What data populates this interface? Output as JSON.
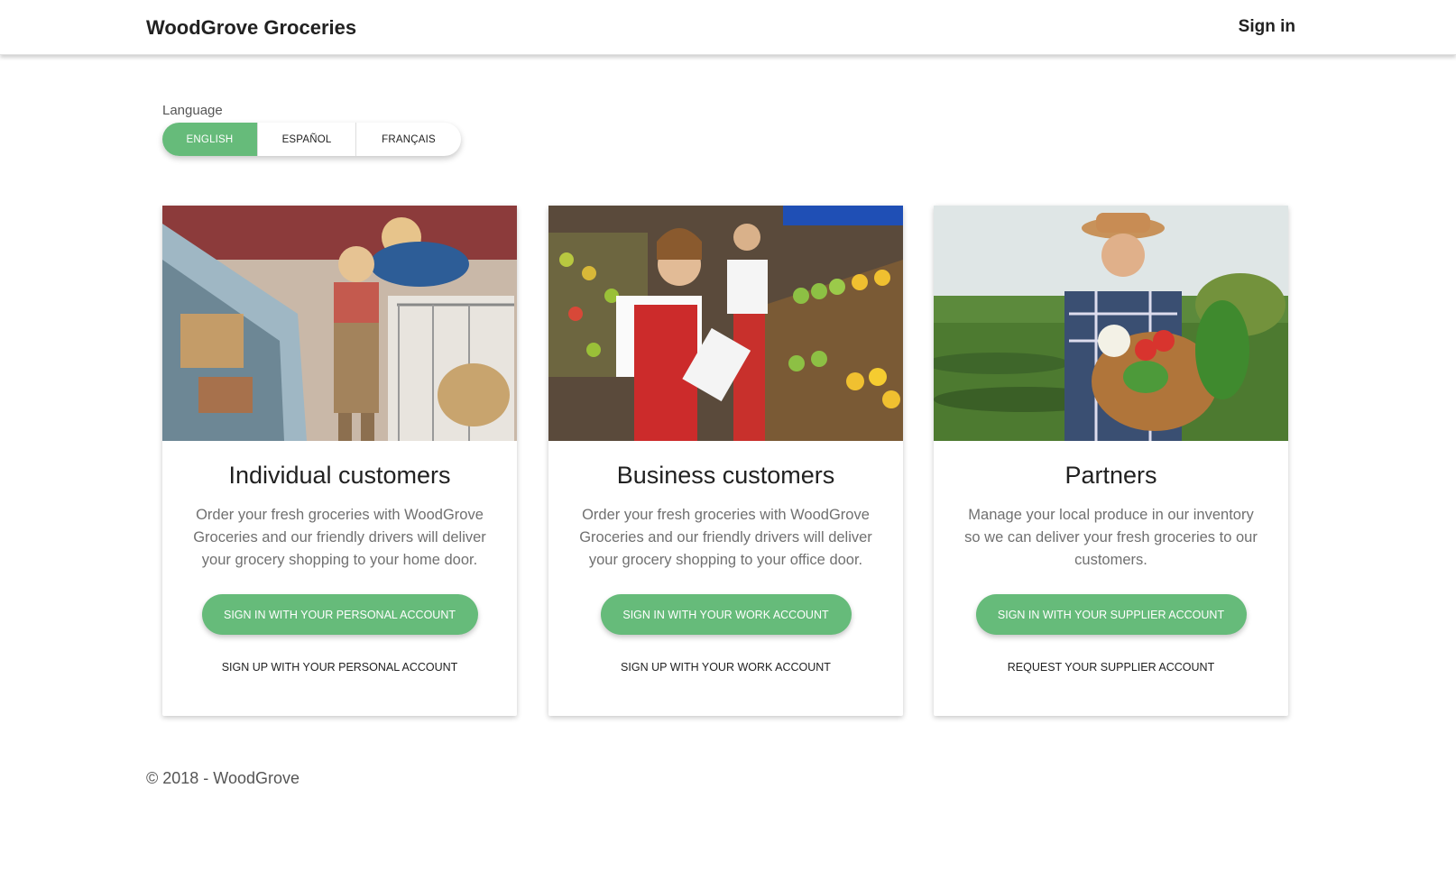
{
  "header": {
    "brand": "WoodGrove Groceries",
    "sign_in": "Sign in"
  },
  "language": {
    "label": "Language",
    "options": [
      "ENGLISH",
      "ESPAÑOL",
      "FRANÇAIS"
    ],
    "selected": "ENGLISH"
  },
  "cards": [
    {
      "title": "Individual customers",
      "text": "Order your fresh groceries with WoodGrove Groceries and our friendly drivers will deliver your grocery shopping to your home door.",
      "primary": "SIGN IN WITH YOUR PERSONAL ACCOUNT",
      "secondary": "SIGN UP WITH YOUR PERSONAL ACCOUNT"
    },
    {
      "title": "Business customers",
      "text": "Order your fresh groceries with WoodGrove Groceries and our friendly drivers will deliver your grocery shopping to your office door.",
      "primary": "SIGN IN WITH YOUR WORK ACCOUNT",
      "secondary": "SIGN UP WITH YOUR WORK ACCOUNT"
    },
    {
      "title": "Partners",
      "text": "Manage your local produce in our inventory so we can deliver your fresh groceries to our customers.",
      "primary": "SIGN IN WITH YOUR SUPPLIER ACCOUNT",
      "secondary": "REQUEST YOUR SUPPLIER ACCOUNT"
    }
  ],
  "footer": {
    "copyright": "© 2018 - WoodGrove"
  },
  "colors": {
    "accent": "#66bb7a",
    "text": "#212121",
    "muted": "#707070"
  }
}
